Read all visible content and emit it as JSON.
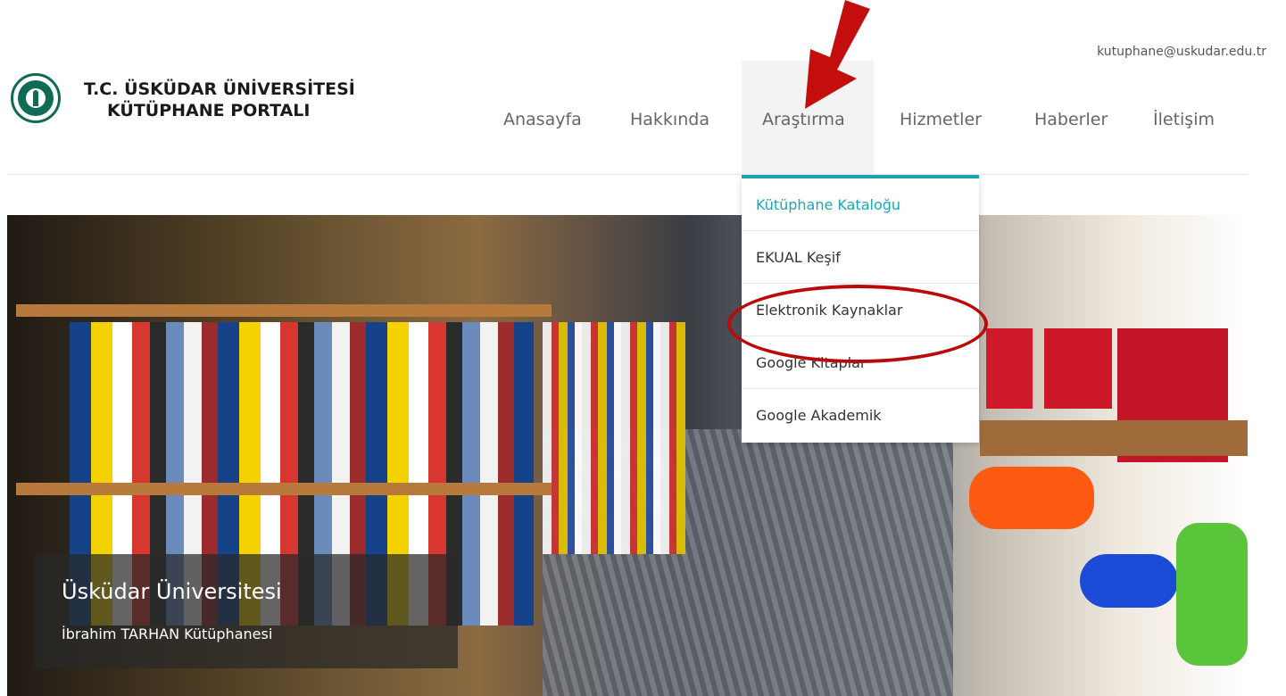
{
  "header": {
    "email": "kutuphane@uskudar.edu.tr",
    "brand_line1": "T.C. ÜSKÜDAR ÜNİVERSİTESİ",
    "brand_line2": "KÜTÜPHANE PORTALI",
    "logo_icon": "university-seal-icon"
  },
  "nav": {
    "items": [
      {
        "label": "Anasayfa"
      },
      {
        "label": "Hakkında"
      },
      {
        "label": "Araştırma"
      },
      {
        "label": "Hizmetler"
      },
      {
        "label": "Haberler"
      },
      {
        "label": "İletişim"
      }
    ],
    "active_index": 2,
    "accent_color": "#1aa7b6"
  },
  "dropdown": {
    "items": [
      {
        "label": "Kütüphane Kataloğu"
      },
      {
        "label": "EKUAL Keşif"
      },
      {
        "label": "Elektronik Kaynaklar"
      },
      {
        "label": "Google Kitaplar"
      },
      {
        "label": "Google Akademik"
      }
    ]
  },
  "hero": {
    "caption_title": "Üsküdar Üniversitesi",
    "caption_subtitle": "İbrahim TARHAN Kütüphanesi"
  },
  "annotations": {
    "highlight_color": "#b90b0b"
  }
}
